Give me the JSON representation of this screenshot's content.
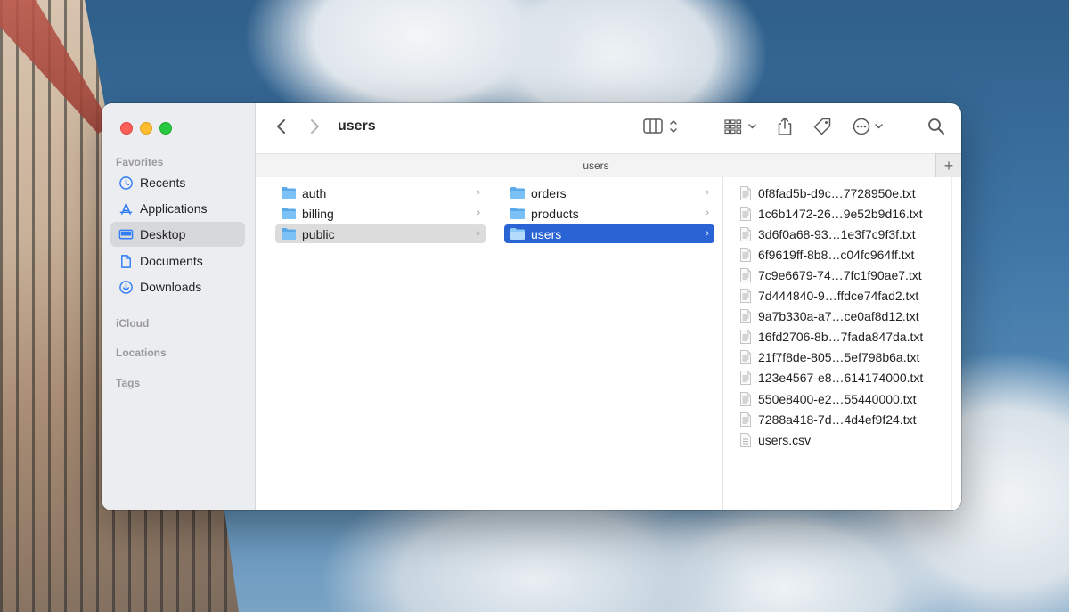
{
  "window": {
    "title": "users",
    "path_label": "users"
  },
  "sidebar": {
    "sections": [
      "Favorites",
      "iCloud",
      "Locations",
      "Tags"
    ],
    "favorites": [
      {
        "label": "Recents",
        "icon": "clock-icon",
        "selected": false
      },
      {
        "label": "Applications",
        "icon": "applications-icon",
        "selected": false
      },
      {
        "label": "Desktop",
        "icon": "desktop-icon",
        "selected": true
      },
      {
        "label": "Documents",
        "icon": "document-icon",
        "selected": false
      },
      {
        "label": "Downloads",
        "icon": "download-icon",
        "selected": false
      }
    ]
  },
  "toolbar": {
    "back_icon": "chevron-left-icon",
    "forward_icon": "chevron-right-icon",
    "view_icon": "column-view-icon",
    "group_icon": "grid-icon",
    "share_icon": "share-icon",
    "tag_icon": "tag-icon",
    "more_icon": "ellipsis-circle-icon",
    "search_icon": "search-icon",
    "add_tab_label": "+"
  },
  "columns": {
    "col1": [
      {
        "label": "auth",
        "selected": false
      },
      {
        "label": "billing",
        "selected": false
      },
      {
        "label": "public",
        "selected": true
      }
    ],
    "col2": [
      {
        "label": "orders",
        "selected": false
      },
      {
        "label": "products",
        "selected": false
      },
      {
        "label": "users",
        "selected": true
      }
    ],
    "col3": [
      "0f8fad5b-d9c…7728950e.txt",
      "1c6b1472-26…9e52b9d16.txt",
      "3d6f0a68-93…1e3f7c9f3f.txt",
      "6f9619ff-8b8…c04fc964ff.txt",
      "7c9e6679-74…7fc1f90ae7.txt",
      "7d444840-9…ffdce74fad2.txt",
      "9a7b330a-a7…ce0af8d12.txt",
      "16fd2706-8b…7fada847da.txt",
      "21f7f8de-805…5ef798b6a.txt",
      "123e4567-e8…614174000.txt",
      "550e8400-e2…55440000.txt",
      "7288a418-7d…4d4ef9f24.txt",
      "users.csv"
    ]
  },
  "colors": {
    "accent": "#2a63d4",
    "sidebar_selected": "#d7d8db"
  }
}
